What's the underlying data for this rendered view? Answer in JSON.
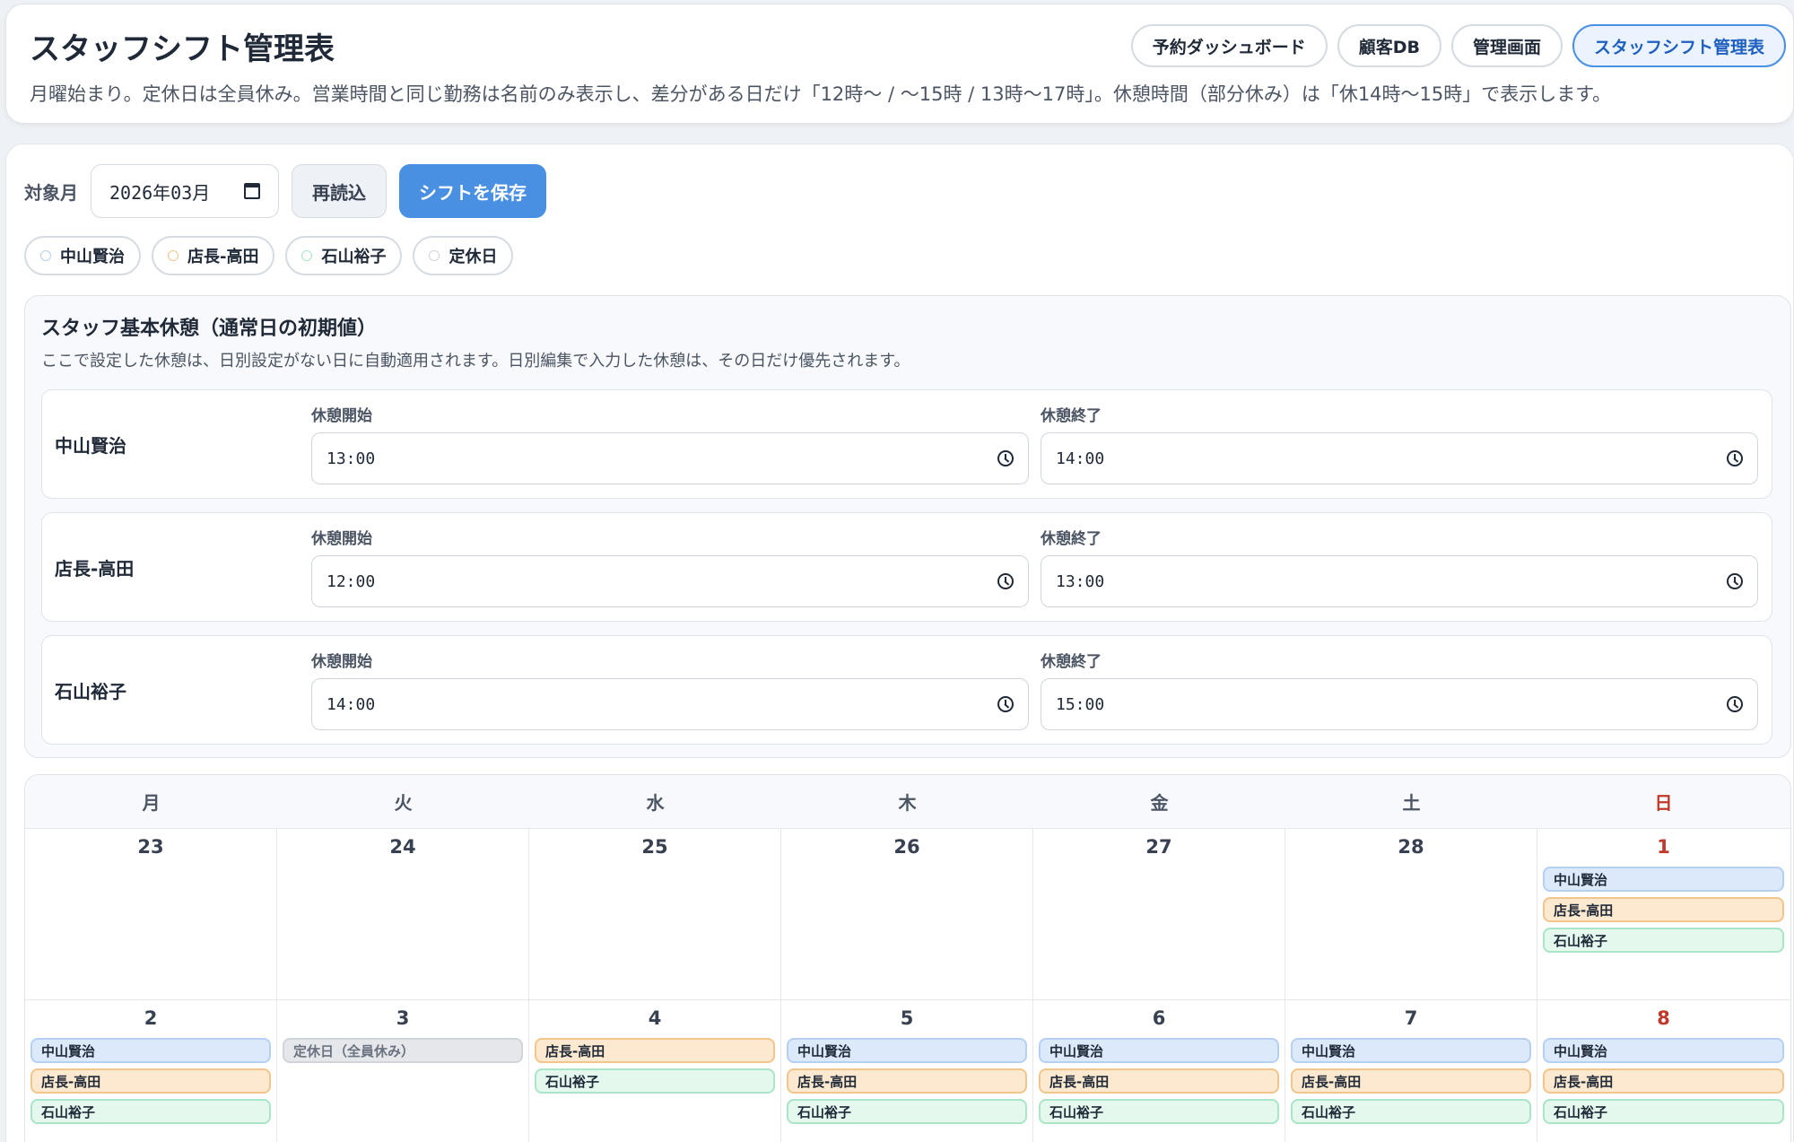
{
  "header": {
    "title": "スタッフシフト管理表",
    "description": "月曜始まり。定休日は全員休み。営業時間と同じ勤務は名前のみ表示し、差分がある日だけ「12時〜 / 〜15時 / 13時〜17時」。休憩時間（部分休み）は「休14時〜15時」で表示します。",
    "nav": [
      "予約ダッシュボード",
      "顧客DB",
      "管理画面",
      "スタッフシフト管理表"
    ],
    "active_nav": "スタッフシフト管理表"
  },
  "toolbar": {
    "month_label": "対象月",
    "month_value": "2026年03月",
    "reload_label": "再読込",
    "save_label": "シフトを保存"
  },
  "legend": [
    {
      "label": "中山賢治",
      "color": "#b5d0f2"
    },
    {
      "label": "店長-高田",
      "color": "#f3c58c"
    },
    {
      "label": "石山裕子",
      "color": "#a9e5c6"
    },
    {
      "label": "定休日",
      "color": "#d1d5db"
    }
  ],
  "breaks": {
    "title": "スタッフ基本休憩（通常日の初期値）",
    "description": "ここで設定した休憩は、日別設定がない日に自動適用されます。日別編集で入力した休憩は、その日だけ優先されます。",
    "start_label": "休憩開始",
    "end_label": "休憩終了",
    "staff": [
      {
        "name": "中山賢治",
        "start": "13:00",
        "end": "14:00"
      },
      {
        "name": "店長-高田",
        "start": "12:00",
        "end": "13:00"
      },
      {
        "name": "石山裕子",
        "start": "14:00",
        "end": "15:00"
      }
    ]
  },
  "calendar": {
    "weekdays": [
      "月",
      "火",
      "水",
      "木",
      "金",
      "土",
      "日"
    ],
    "weeks": [
      [
        {
          "day": "23",
          "entries": []
        },
        {
          "day": "24",
          "entries": []
        },
        {
          "day": "25",
          "entries": []
        },
        {
          "day": "26",
          "entries": []
        },
        {
          "day": "27",
          "entries": []
        },
        {
          "day": "28",
          "entries": []
        },
        {
          "day": "1",
          "entries": [
            {
              "label": "中山賢治",
              "type": "blue"
            },
            {
              "label": "店長-高田",
              "type": "orange"
            },
            {
              "label": "石山裕子",
              "type": "green"
            }
          ]
        }
      ],
      [
        {
          "day": "2",
          "entries": [
            {
              "label": "中山賢治",
              "type": "blue"
            },
            {
              "label": "店長-高田",
              "type": "orange"
            },
            {
              "label": "石山裕子",
              "type": "green"
            }
          ]
        },
        {
          "day": "3",
          "entries": [
            {
              "label": "定休日（全員休み）",
              "type": "gray"
            }
          ]
        },
        {
          "day": "4",
          "entries": [
            {
              "label": "店長-高田",
              "type": "orange"
            },
            {
              "label": "石山裕子",
              "type": "green"
            }
          ]
        },
        {
          "day": "5",
          "entries": [
            {
              "label": "中山賢治",
              "type": "blue"
            },
            {
              "label": "店長-高田",
              "type": "orange"
            },
            {
              "label": "石山裕子",
              "type": "green"
            }
          ]
        },
        {
          "day": "6",
          "entries": [
            {
              "label": "中山賢治",
              "type": "blue"
            },
            {
              "label": "店長-高田",
              "type": "orange"
            },
            {
              "label": "石山裕子",
              "type": "green"
            }
          ]
        },
        {
          "day": "7",
          "entries": [
            {
              "label": "中山賢治",
              "type": "blue"
            },
            {
              "label": "店長-高田",
              "type": "orange"
            },
            {
              "label": "石山裕子",
              "type": "green"
            }
          ]
        },
        {
          "day": "8",
          "entries": [
            {
              "label": "中山賢治",
              "type": "blue"
            },
            {
              "label": "店長-高田",
              "type": "orange"
            },
            {
              "label": "石山裕子",
              "type": "green"
            }
          ]
        }
      ]
    ]
  }
}
